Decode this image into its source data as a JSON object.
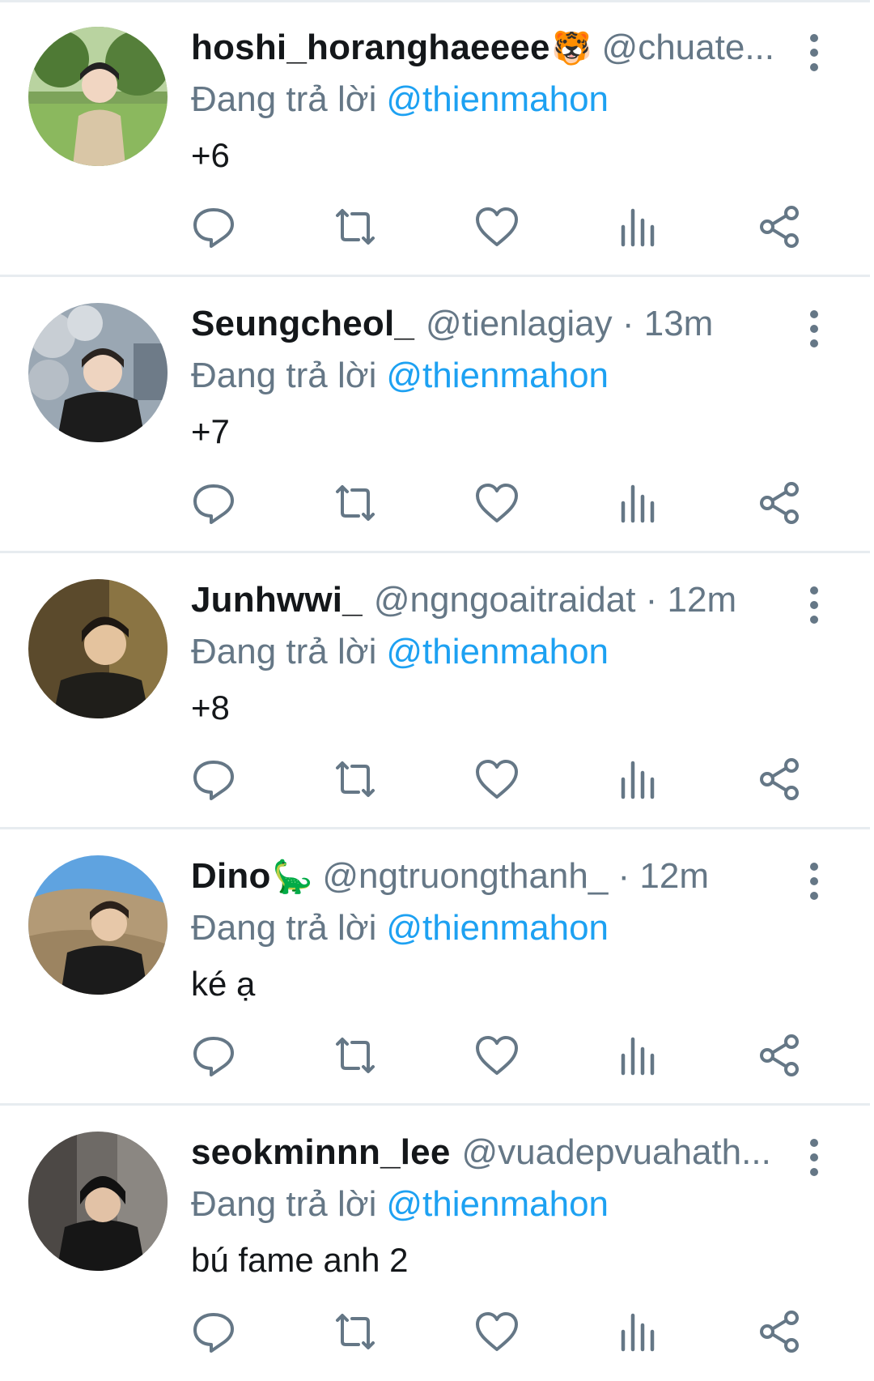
{
  "replying_label": "Đang trả lời",
  "colors": {
    "text": "#14171a",
    "secondary": "#657786",
    "link": "#1da1f2",
    "divider": "#e7ecf0"
  },
  "icons": [
    "reply-icon",
    "retweet-icon",
    "like-icon",
    "analytics-icon",
    "share-icon",
    "more-icon"
  ],
  "tweets": [
    {
      "name": "hoshi_horanghaeeee",
      "emoji": "🐯",
      "handle": "@chuate...",
      "time": "",
      "replying_to": "@thienmahon",
      "text": "+6"
    },
    {
      "name": "Seungcheol_",
      "emoji": "",
      "handle": "@tienlagiay",
      "time": " · 13m",
      "replying_to": "@thienmahon",
      "text": "+7"
    },
    {
      "name": "Junhwwi_",
      "emoji": "",
      "handle": "@ngngoaitraidat",
      "time": " · 12m",
      "replying_to": "@thienmahon",
      "text": "+8"
    },
    {
      "name": "Dino",
      "emoji": "🦕",
      "handle": "@ngtruongthanh_",
      "time": " · 12m",
      "replying_to": "@thienmahon",
      "text": "ké ạ"
    },
    {
      "name": "seokminnn_lee",
      "emoji": "",
      "handle": "@vuadepvuahath...",
      "time": "",
      "replying_to": "@thienmahon",
      "text": "bú fame anh 2"
    }
  ]
}
